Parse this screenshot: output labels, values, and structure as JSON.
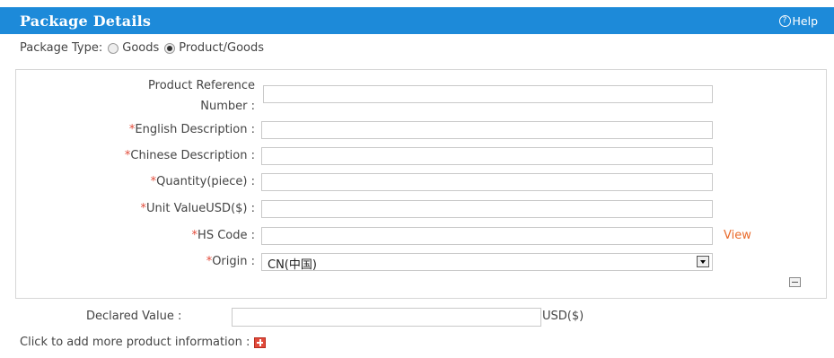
{
  "header": {
    "title": "Package Details",
    "help_label": "Help"
  },
  "package_type": {
    "label": "Package Type:",
    "options": [
      {
        "label": "Goods",
        "selected": false
      },
      {
        "label": "Product/Goods",
        "selected": true
      }
    ]
  },
  "form": {
    "product_ref_label_line1": "Product Reference",
    "product_ref_label_line2": "Number :",
    "english_desc_label": "English Description :",
    "chinese_desc_label": "Chinese Description :",
    "quantity_label": "Quantity(piece) :",
    "unit_value_label": "Unit ValueUSD($) :",
    "hs_code_label": "HS Code :",
    "hs_view_label": "View",
    "origin_label": "Origin :",
    "origin_value": "CN(中国)",
    "required_mark": "*"
  },
  "declared": {
    "label": "Declared Value :",
    "unit": "USD($)"
  },
  "add_more": {
    "label": "Click to add more product information :"
  },
  "colors": {
    "header_bg": "#1d8ad9",
    "required": "#e34b3a",
    "link": "#e96a2a",
    "add_button": "#e24a3b"
  }
}
